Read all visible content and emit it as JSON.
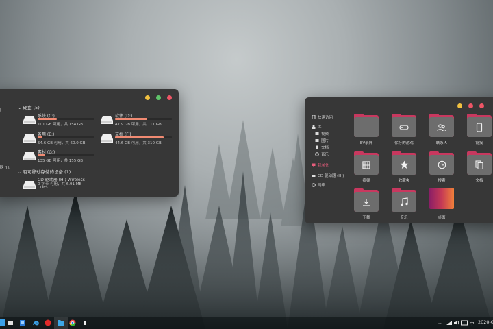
{
  "colors": {
    "accent": "#c8385f",
    "usage_bar": "#f08a72",
    "window_bg": "#373737"
  },
  "left_window": {
    "disks_header": "硬盘 (5)",
    "drives": [
      {
        "name": "系统 (C:)",
        "size": "101 GB 可用，共 154 GB",
        "used_fraction": 0.34
      },
      {
        "name": "软件 (D:)",
        "size": "47.9 GB 可用，共 111 GB",
        "used_fraction": 0.57
      },
      {
        "name": "备用 (E:)",
        "size": "54.6 GB 可用，共 60.0 GB",
        "used_fraction": 0.09
      },
      {
        "name": "文档 (F:)",
        "size": "44.6 GB 可用，共 310 GB",
        "used_fraction": 0.86
      },
      {
        "name": "素材 (G:)",
        "size": "135 GB 可用，共 155 GB",
        "used_fraction": 0.13
      }
    ],
    "removable_header": "有可移动存储的设备 (1)",
    "cd_drive": {
      "name": "CD 驱动器 (H:) Wireless",
      "size": "0 字节 可用，共 6.91 MB",
      "fs": "CDFS"
    },
    "nav": [
      "问",
      "(H:)",
      "动器 (H:"
    ]
  },
  "right_window": {
    "nav": [
      {
        "label": "快速访问",
        "icon": "quick-access-icon"
      },
      {
        "label": "库",
        "icon": "library-icon"
      },
      {
        "label": "视频",
        "icon": "video-icon"
      },
      {
        "label": "图片",
        "icon": "picture-icon"
      },
      {
        "label": "文档",
        "icon": "document-icon"
      },
      {
        "label": "音乐",
        "icon": "music-icon"
      },
      {
        "label": "我美化",
        "icon": "computer-icon",
        "active": true
      },
      {
        "label": "CD 驱动器 (H:)",
        "icon": "cd-icon"
      },
      {
        "label": "网络",
        "icon": "network-icon"
      }
    ],
    "folders": [
      {
        "label": "EV录屏",
        "icon": ""
      },
      {
        "label": "保存的游戏",
        "icon": "gamepad-icon"
      },
      {
        "label": "联系人",
        "icon": "contacts-icon"
      },
      {
        "label": "链接",
        "icon": "link-icon"
      },
      {
        "label": "视频",
        "icon": "film-icon"
      },
      {
        "label": "收藏夹",
        "icon": "star-icon"
      },
      {
        "label": "搜索",
        "icon": "search-icon"
      },
      {
        "label": "文档",
        "icon": "document-icon"
      },
      {
        "label": "下载",
        "icon": "download-icon"
      },
      {
        "label": "音乐",
        "icon": "music-note-icon"
      },
      {
        "label": "桌面",
        "icon": "desktop-icon"
      }
    ]
  },
  "taskbar": {
    "apps": [
      "start-icon",
      "explorer-icon",
      "store-icon",
      "edge-icon",
      "netease-music-icon",
      "folder-icon",
      "chrome-icon",
      "terminal-icon"
    ],
    "tray": {
      "more": "...",
      "ime": "中",
      "clock": "2020-0"
    }
  }
}
